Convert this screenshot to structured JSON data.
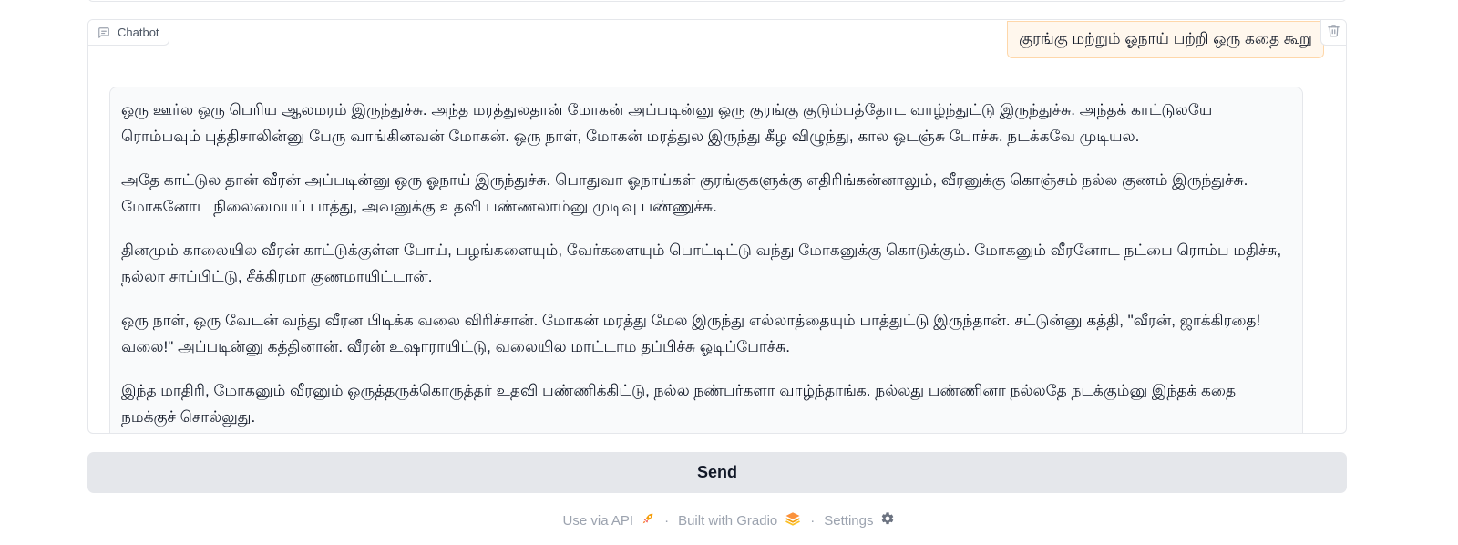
{
  "chatbot": {
    "label": "Chatbot",
    "label_icon": "chat-bubble-icon",
    "clear_icon": "trash-icon"
  },
  "user_message": "குரங்கு மற்றும் ஓநாய் பற்றி ஒரு கதை கூறு",
  "bot_message": {
    "paragraphs": [
      "ஒரு ஊர்ல ஒரு பெரிய ஆலமரம் இருந்துச்சு. அந்த மரத்துலதான் மோகன் அப்படின்னு ஒரு குரங்கு குடும்பத்தோட வாழ்ந்துட்டு இருந்துச்சு. அந்தக் காட்டுலயே ரொம்பவும் புத்திசாலின்னு பேரு வாங்கினவன் மோகன். ஒரு நாள், மோகன் மரத்துல இருந்து கீழ விழுந்து, கால ஒடஞ்சு போச்சு. நடக்கவே முடியல.",
      "அதே காட்டுல தான் வீரன் அப்படின்னு ஒரு ஓநாய் இருந்துச்சு. பொதுவா ஓநாய்கள் குரங்குகளுக்கு எதிரிங்கன்னாலும், வீரனுக்கு கொஞ்சம் நல்ல குணம் இருந்துச்சு. மோகனோட நிலைமையப் பாத்து, அவனுக்கு உதவி பண்ணலாம்னு முடிவு பண்ணுச்சு.",
      "தினமும் காலையில வீரன் காட்டுக்குள்ள போய், பழங்களையும், வேர்களையும் பொட்டிட்டு வந்து மோகனுக்கு கொடுக்கும். மோகனும் வீரனோட நட்பை ரொம்ப மதிச்சு, நல்லா சாப்பிட்டு, சீக்கிரமா குணமாயிட்டான்.",
      "ஒரு நாள், ஒரு வேடன் வந்து வீரன பிடிக்க வலை விரிச்சான். மோகன் மரத்து மேல இருந்து எல்லாத்தையும் பாத்துட்டு இருந்தான். சட்டுன்னு கத்தி, \"வீரன், ஜாக்கிரதை! வலை!\" அப்படின்னு கத்தினான். வீரன் உஷாராயிட்டு, வலையில மாட்டாம தப்பிச்சு ஓடிப்போச்சு.",
      "இந்த மாதிரி, மோகனும் வீரனும் ஒருத்தருக்கொருத்தர் உதவி பண்ணிக்கிட்டு, நல்ல நண்பர்களா வாழ்ந்தாங்க. நல்லது பண்ணினா நல்லதே நடக்கும்னு இந்தக் கதை நமக்குச் சொல்லுது."
    ]
  },
  "send_button": "Send",
  "footer": {
    "api_label": "Use via API",
    "api_icon": "rocket-icon",
    "separator": "·",
    "gradio_label": "Built with Gradio",
    "gradio_icon": "gradio-logo-icon",
    "settings_label": "Settings",
    "settings_icon": "gear-icon"
  }
}
